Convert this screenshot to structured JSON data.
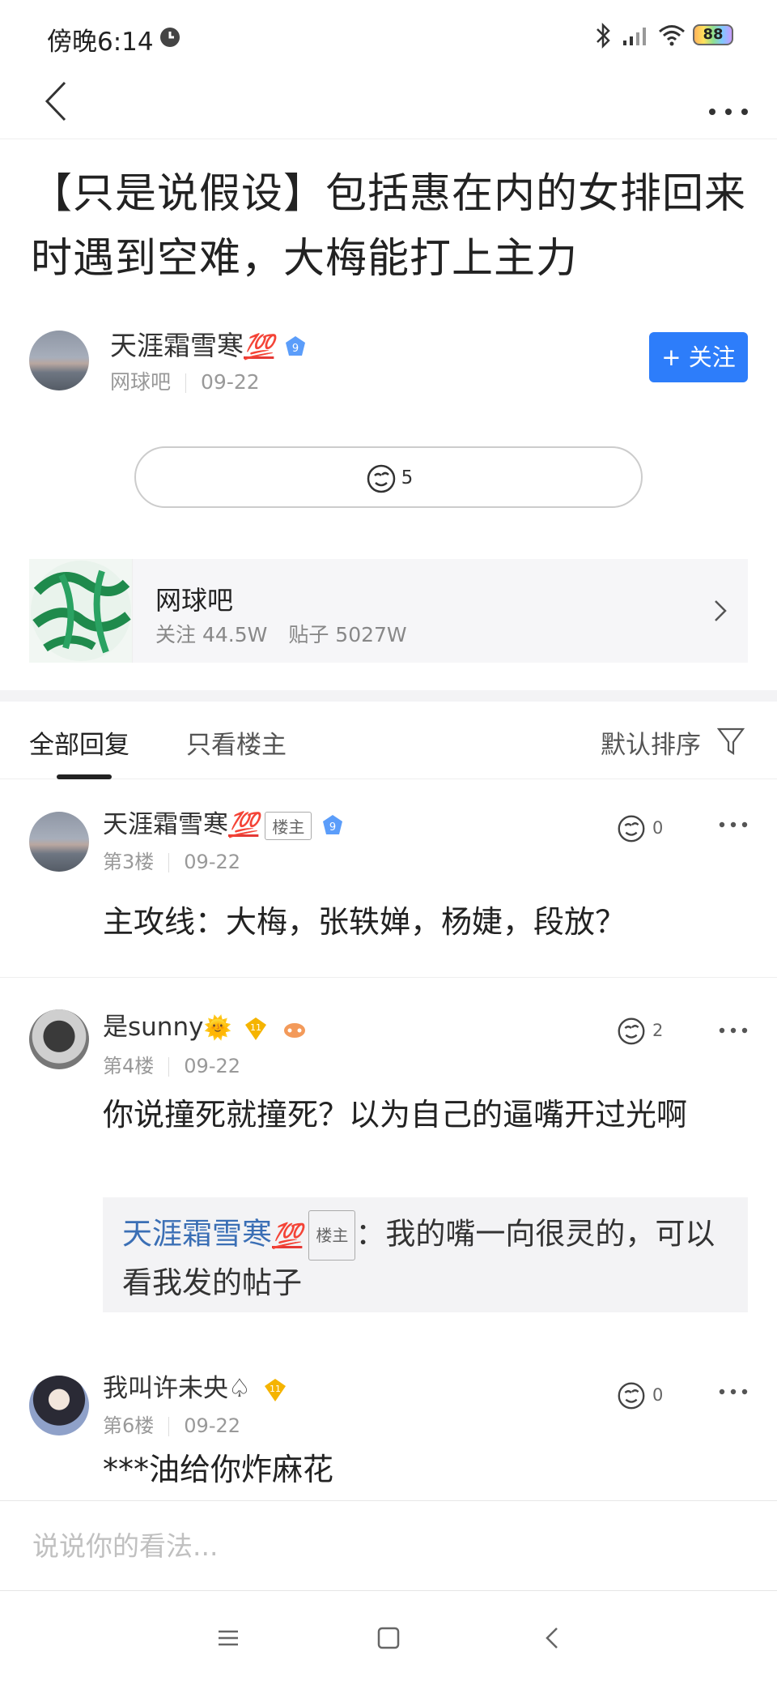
{
  "status_bar": {
    "time": "傍晚6:14",
    "battery": "88"
  },
  "post": {
    "title": "【只是说假设】包括惠在内的女排回来时遇到空难，大梅能打上主力",
    "author": {
      "name": "天涯霜雪寒",
      "name_emoji": "💯",
      "level": "9",
      "forum": "网球吧",
      "date": "09-22"
    },
    "follow_label": "+ 关注",
    "like_count": "5"
  },
  "forum_card": {
    "name": "网球吧",
    "followers": "关注 44.5W",
    "posts": "贴子 5027W"
  },
  "tabs": {
    "all": "全部回复",
    "owner_only": "只看楼主",
    "sort": "默认排序"
  },
  "replies": [
    {
      "name": "天涯霜雪寒",
      "emoji": "💯",
      "owner_tag": "楼主",
      "level": "9",
      "floor": "第3楼",
      "date": "09-22",
      "likes": "0",
      "text": "主攻线：大梅，张轶婵，杨婕，段放？"
    },
    {
      "name": "是sunny",
      "emoji": "🌞",
      "level": "11",
      "floor": "第4楼",
      "date": "09-22",
      "likes": "2",
      "text": "你说撞死就撞死？以为自己的逼嘴开过光啊",
      "quote": {
        "name": "天涯霜雪寒",
        "emoji": "💯",
        "owner_tag": "楼主",
        "text": "：我的嘴一向很灵的，可以看我发的帖子"
      }
    },
    {
      "name": "我叫许未央♤",
      "level": "11",
      "floor": "第6楼",
      "date": "09-22",
      "likes": "0",
      "text": "***油给你炸麻花"
    }
  ],
  "comment_bar": {
    "placeholder": "说说你的看法..."
  },
  "colors": {
    "accent": "#2d7dfa",
    "quote_name": "#3b6fb5",
    "badge_blue": "#5b9dfa",
    "badge_gold": "#f5b400"
  },
  "icons": [
    "alarm-icon",
    "bluetooth-icon",
    "signal-icon",
    "wifi-icon",
    "back-icon",
    "more-icon",
    "like-icon",
    "chevron-right-icon",
    "filter-icon",
    "menu-icon",
    "home-icon",
    "back-nav-icon"
  ]
}
